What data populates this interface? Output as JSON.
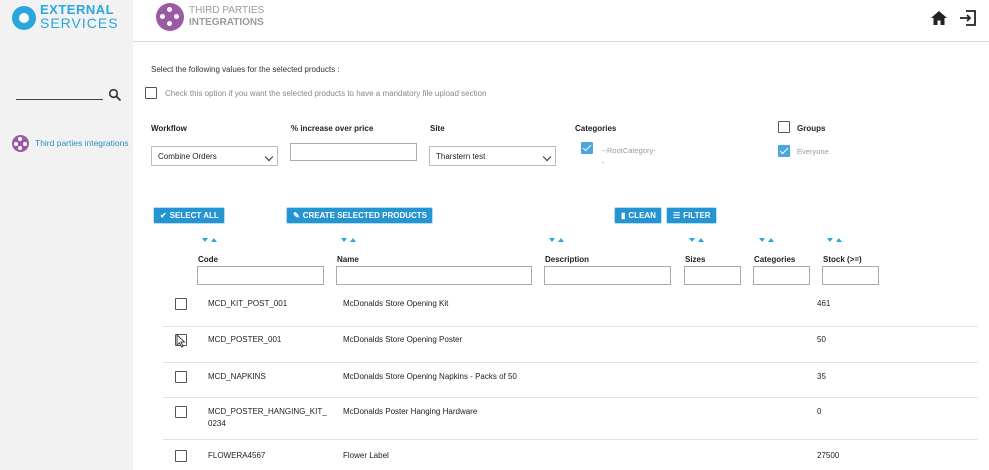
{
  "header": {
    "brand_line1": "EXTERNAL",
    "brand_line2": "SERVICES",
    "module_line1": "THIRD PARTIES",
    "module_line2": "INTEGRATIONS",
    "icons": [
      "home-icon",
      "logout-icon"
    ]
  },
  "sidebar": {
    "search_placeholder": "",
    "items": [
      {
        "label": "Third parties integrations",
        "icon": "integration-icon"
      }
    ]
  },
  "form": {
    "instruction": "Select the following values for the selected products :",
    "mandatory_upload_label": "Check this option if you want the selected products to have a mandatory file upload section",
    "mandatory_upload_checked": false,
    "workflow_label": "Workflow",
    "workflow_value": "Combine Orders",
    "increase_label": "% increase over price",
    "increase_value": "",
    "site_label": "Site",
    "site_value": "Tharstern test",
    "categories_label": "Categories",
    "categories_value": "--RootCategory-",
    "categories_value_extra": "-",
    "groups_label": "Groups",
    "groups_value": "Everyone"
  },
  "toolbar": {
    "select_all": "SELECT ALL",
    "create_selected": "CREATE SELECTED PRODUCTS",
    "clean": "CLEAN",
    "filter": "FILTER"
  },
  "table": {
    "columns": [
      "Code",
      "Name",
      "Description",
      "Sizes",
      "Categories",
      "Stock (>=)"
    ],
    "rows": [
      {
        "code": "MCD_KIT_POST_001",
        "name": "McDonalds Store Opening Kit",
        "description": "",
        "stock": "461"
      },
      {
        "code": "MCD_POSTER_001",
        "name": "McDonalds Store Opening Poster",
        "description": "",
        "stock": "50"
      },
      {
        "code": "MCD_NAPKINS",
        "name": "McDonalds Store Opening Napkins - Packs of 50",
        "description": "",
        "stock": "35"
      },
      {
        "code": "MCD_POSTER_HANGING_KIT_",
        "code2": "0234",
        "name": "McDonalds Poster Hanging Hardware",
        "description": "",
        "stock": "0"
      },
      {
        "code": "FLOWERA4567",
        "name": "Flower Label",
        "description": "",
        "stock": "27500"
      }
    ]
  },
  "colors": {
    "accent": "#2494d3",
    "brand": "#2aa7df",
    "module": "#9b5aa3"
  }
}
